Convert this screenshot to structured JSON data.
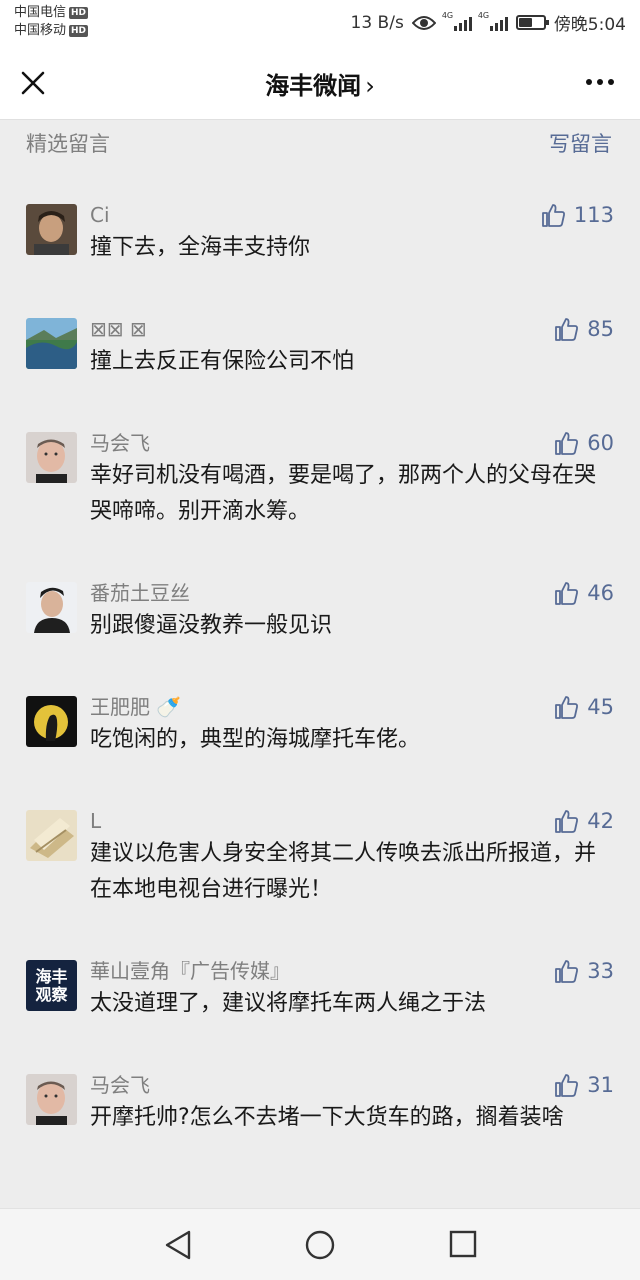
{
  "status": {
    "carrier1": "中国电信",
    "carrier2": "中国移动",
    "hd": "HD",
    "speed": "13 B/s",
    "net_tag": "4G",
    "time": "傍晚5:04"
  },
  "header": {
    "title": "海丰微闻",
    "chevron": "›"
  },
  "section": {
    "title": "精选留言",
    "write": "写留言"
  },
  "comments": [
    {
      "name": "Ci",
      "text": "撞下去，全海丰支持你",
      "likes": "113"
    },
    {
      "name": "⊠⊠ ⊠",
      "text": "撞上去反正有保险公司不怕",
      "likes": "85"
    },
    {
      "name": "马会飞",
      "text": "幸好司机没有喝酒，要是喝了，那两个人的父母在哭哭啼啼。别开滴水筹。",
      "likes": "60"
    },
    {
      "name": "番茄土豆丝",
      "text": "别跟傻逼没教养一般见识",
      "likes": "46"
    },
    {
      "name": "王肥肥 🍼",
      "text": "吃饱闲的，典型的海城摩托车佬。",
      "likes": "45"
    },
    {
      "name": "L",
      "text": "建议以危害人身安全将其二人传唤去派出所报道，并在本地电视台进行曝光！",
      "likes": "42"
    },
    {
      "name": "華山壹角『广告传媒』",
      "text": "太没道理了，建议将摩托车两人绳之于法",
      "likes": "33"
    },
    {
      "name": "马会飞",
      "text": "开摩托帅?怎么不去堵一下大货车的路，搁着装啥",
      "likes": "31"
    }
  ],
  "avatar4_text": {
    "line1": "海丰",
    "line2": "观察"
  },
  "battery_level": 0.55
}
